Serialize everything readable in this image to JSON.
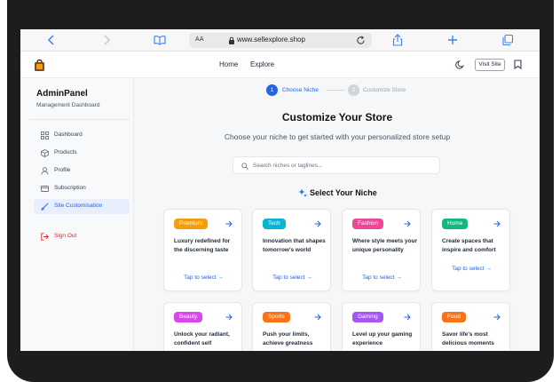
{
  "browser": {
    "reader_label": "AA",
    "url": "www.sellexplore.shop"
  },
  "nav": {
    "links": [
      "Home",
      "Explore"
    ],
    "visit_site": "Visit Site"
  },
  "sidebar": {
    "title": "AdminPanel",
    "subtitle": "Management Dashboard",
    "items": [
      {
        "label": "Dashboard",
        "icon": "grid-icon"
      },
      {
        "label": "Products",
        "icon": "box-icon"
      },
      {
        "label": "Profile",
        "icon": "user-icon"
      },
      {
        "label": "Subscription",
        "icon": "card-icon"
      },
      {
        "label": "Site Customisation",
        "icon": "brush-icon",
        "active": true
      }
    ],
    "signout": "Sign Out"
  },
  "steps": [
    {
      "number": "1",
      "label": "Choose Niche"
    },
    {
      "number": "2",
      "label": "Customize Store"
    }
  ],
  "main": {
    "title": "Customize Your Store",
    "subtitle": "Choose your niche to get started with your personalized store setup",
    "search_placeholder": "Search niches or taglines...",
    "section_title": "Select Your Niche"
  },
  "niches": [
    {
      "name": "Premium",
      "tagline": "Luxury redefined for the discerning taste",
      "cta": "Tap to select →",
      "color": "#f59e0b"
    },
    {
      "name": "Tech",
      "tagline": "Innovation that shapes tomorrow's world",
      "cta": "Tap to select →",
      "color": "#06b6d4"
    },
    {
      "name": "Fashion",
      "tagline": "Where style meets your unique personality",
      "cta": "Tap to select →",
      "color": "#ec4899"
    },
    {
      "name": "Home",
      "tagline": "Create spaces that inspire and comfort",
      "cta": "Tap to select →",
      "color": "#10b981"
    },
    {
      "name": "Beauty",
      "tagline": "Unlock your radiant, confident self",
      "cta": "",
      "color": "#d946ef"
    },
    {
      "name": "Sports",
      "tagline": "Push your limits, achieve greatness",
      "cta": "",
      "color": "#f97316"
    },
    {
      "name": "Gaming",
      "tagline": "Level up your gaming experience",
      "cta": "",
      "color": "#a855f7"
    },
    {
      "name": "Food",
      "tagline": "Savor life's most delicious moments",
      "cta": "",
      "color": "#f97316"
    }
  ],
  "colors": {
    "accent": "#2563eb",
    "danger": "#dc2626"
  }
}
